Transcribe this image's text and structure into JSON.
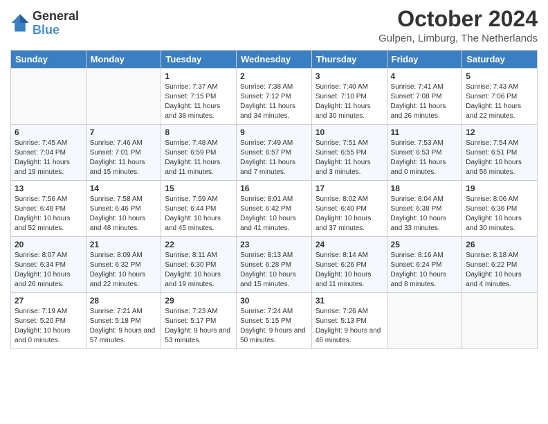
{
  "logo": {
    "line1": "General",
    "line2": "Blue"
  },
  "header": {
    "title": "October 2024",
    "subtitle": "Gulpen, Limburg, The Netherlands"
  },
  "columns": [
    "Sunday",
    "Monday",
    "Tuesday",
    "Wednesday",
    "Thursday",
    "Friday",
    "Saturday"
  ],
  "weeks": [
    [
      {
        "day": "",
        "info": ""
      },
      {
        "day": "",
        "info": ""
      },
      {
        "day": "1",
        "info": "Sunrise: 7:37 AM\nSunset: 7:15 PM\nDaylight: 11 hours and 38 minutes."
      },
      {
        "day": "2",
        "info": "Sunrise: 7:38 AM\nSunset: 7:12 PM\nDaylight: 11 hours and 34 minutes."
      },
      {
        "day": "3",
        "info": "Sunrise: 7:40 AM\nSunset: 7:10 PM\nDaylight: 11 hours and 30 minutes."
      },
      {
        "day": "4",
        "info": "Sunrise: 7:41 AM\nSunset: 7:08 PM\nDaylight: 11 hours and 26 minutes."
      },
      {
        "day": "5",
        "info": "Sunrise: 7:43 AM\nSunset: 7:06 PM\nDaylight: 11 hours and 22 minutes."
      }
    ],
    [
      {
        "day": "6",
        "info": "Sunrise: 7:45 AM\nSunset: 7:04 PM\nDaylight: 11 hours and 19 minutes."
      },
      {
        "day": "7",
        "info": "Sunrise: 7:46 AM\nSunset: 7:01 PM\nDaylight: 11 hours and 15 minutes."
      },
      {
        "day": "8",
        "info": "Sunrise: 7:48 AM\nSunset: 6:59 PM\nDaylight: 11 hours and 11 minutes."
      },
      {
        "day": "9",
        "info": "Sunrise: 7:49 AM\nSunset: 6:57 PM\nDaylight: 11 hours and 7 minutes."
      },
      {
        "day": "10",
        "info": "Sunrise: 7:51 AM\nSunset: 6:55 PM\nDaylight: 11 hours and 3 minutes."
      },
      {
        "day": "11",
        "info": "Sunrise: 7:53 AM\nSunset: 6:53 PM\nDaylight: 11 hours and 0 minutes."
      },
      {
        "day": "12",
        "info": "Sunrise: 7:54 AM\nSunset: 6:51 PM\nDaylight: 10 hours and 56 minutes."
      }
    ],
    [
      {
        "day": "13",
        "info": "Sunrise: 7:56 AM\nSunset: 6:48 PM\nDaylight: 10 hours and 52 minutes."
      },
      {
        "day": "14",
        "info": "Sunrise: 7:58 AM\nSunset: 6:46 PM\nDaylight: 10 hours and 48 minutes."
      },
      {
        "day": "15",
        "info": "Sunrise: 7:59 AM\nSunset: 6:44 PM\nDaylight: 10 hours and 45 minutes."
      },
      {
        "day": "16",
        "info": "Sunrise: 8:01 AM\nSunset: 6:42 PM\nDaylight: 10 hours and 41 minutes."
      },
      {
        "day": "17",
        "info": "Sunrise: 8:02 AM\nSunset: 6:40 PM\nDaylight: 10 hours and 37 minutes."
      },
      {
        "day": "18",
        "info": "Sunrise: 8:04 AM\nSunset: 6:38 PM\nDaylight: 10 hours and 33 minutes."
      },
      {
        "day": "19",
        "info": "Sunrise: 8:06 AM\nSunset: 6:36 PM\nDaylight: 10 hours and 30 minutes."
      }
    ],
    [
      {
        "day": "20",
        "info": "Sunrise: 8:07 AM\nSunset: 6:34 PM\nDaylight: 10 hours and 26 minutes."
      },
      {
        "day": "21",
        "info": "Sunrise: 8:09 AM\nSunset: 6:32 PM\nDaylight: 10 hours and 22 minutes."
      },
      {
        "day": "22",
        "info": "Sunrise: 8:11 AM\nSunset: 6:30 PM\nDaylight: 10 hours and 19 minutes."
      },
      {
        "day": "23",
        "info": "Sunrise: 8:13 AM\nSunset: 6:28 PM\nDaylight: 10 hours and 15 minutes."
      },
      {
        "day": "24",
        "info": "Sunrise: 8:14 AM\nSunset: 6:26 PM\nDaylight: 10 hours and 11 minutes."
      },
      {
        "day": "25",
        "info": "Sunrise: 8:16 AM\nSunset: 6:24 PM\nDaylight: 10 hours and 8 minutes."
      },
      {
        "day": "26",
        "info": "Sunrise: 8:18 AM\nSunset: 6:22 PM\nDaylight: 10 hours and 4 minutes."
      }
    ],
    [
      {
        "day": "27",
        "info": "Sunrise: 7:19 AM\nSunset: 5:20 PM\nDaylight: 10 hours and 0 minutes."
      },
      {
        "day": "28",
        "info": "Sunrise: 7:21 AM\nSunset: 5:18 PM\nDaylight: 9 hours and 57 minutes."
      },
      {
        "day": "29",
        "info": "Sunrise: 7:23 AM\nSunset: 5:17 PM\nDaylight: 9 hours and 53 minutes."
      },
      {
        "day": "30",
        "info": "Sunrise: 7:24 AM\nSunset: 5:15 PM\nDaylight: 9 hours and 50 minutes."
      },
      {
        "day": "31",
        "info": "Sunrise: 7:26 AM\nSunset: 5:13 PM\nDaylight: 9 hours and 46 minutes."
      },
      {
        "day": "",
        "info": ""
      },
      {
        "day": "",
        "info": ""
      }
    ]
  ]
}
